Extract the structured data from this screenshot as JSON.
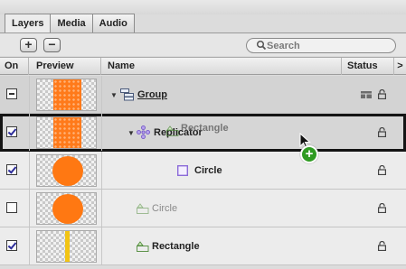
{
  "tabs": [
    {
      "label": "Layers",
      "active": true
    },
    {
      "label": "Media",
      "active": false
    },
    {
      "label": "Audio",
      "active": false
    }
  ],
  "toolbar": {
    "add_label": "+",
    "remove_label": "−",
    "search_placeholder": "Search"
  },
  "columns": {
    "on": "On",
    "preview": "Preview",
    "name": "Name",
    "status": "Status",
    "scroll": ">"
  },
  "rows": [
    {
      "name": "Group",
      "checkbox": "mixed",
      "icon": "group-icon",
      "disclosure": "open",
      "thumb": "orange-rect"
    },
    {
      "name": "Replicator",
      "checkbox": "checked",
      "icon": "replicator-icon",
      "disclosure": "open",
      "thumb": "orange-rect",
      "selected": true
    },
    {
      "name": "Circle",
      "checkbox": "checked",
      "icon": "shape-icon",
      "thumb": "orange-circle"
    },
    {
      "name": "Circle",
      "checkbox": "unchecked",
      "icon": "shape-layer-icon",
      "thumb": "orange-circle",
      "dimmed": true
    },
    {
      "name": "Rectangle",
      "checkbox": "checked",
      "icon": "shape-layer-icon",
      "thumb": "yellow-bar"
    }
  ],
  "drag": {
    "label": "Rectangle",
    "badge": "+"
  },
  "colors": {
    "accent_orange": "#ff7a1a",
    "selection_outline": "#141414",
    "shape_icon_purple": "#8b6bd8",
    "add_badge_green": "#2f9b22"
  }
}
